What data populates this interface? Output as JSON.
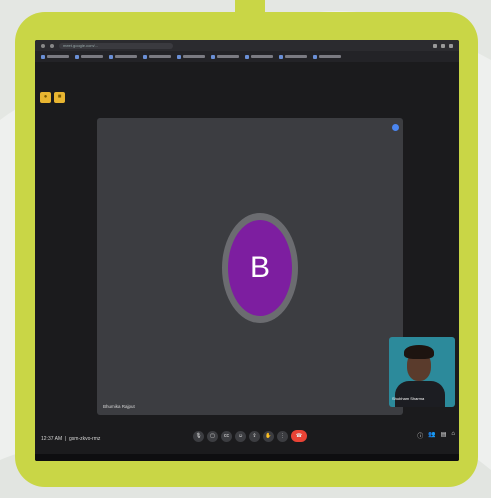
{
  "browser": {
    "url": "meet.google.com/...",
    "bookmarks": [
      "",
      "",
      "",
      "",
      "",
      "",
      "",
      "",
      "",
      ""
    ]
  },
  "meeting": {
    "participant_initial": "B",
    "participant_name": "Bhumika Rajput",
    "self_name": "Shubham Sharma",
    "time": "12:37 AM",
    "meeting_code": "gsm-zkvo-rmz",
    "controls": [
      "mic-icon",
      "camera-icon",
      "captions-icon",
      "emoji-icon",
      "present-icon",
      "raise-hand-icon",
      "more-icon",
      "end-call-icon"
    ],
    "right_controls": [
      "info-icon",
      "people-icon",
      "chat-icon",
      "activities-icon"
    ]
  },
  "colors": {
    "frame": "#c9d646",
    "avatar": "#7d1ea0",
    "end_call": "#ea4335",
    "yellow_button": "#e8b531"
  }
}
